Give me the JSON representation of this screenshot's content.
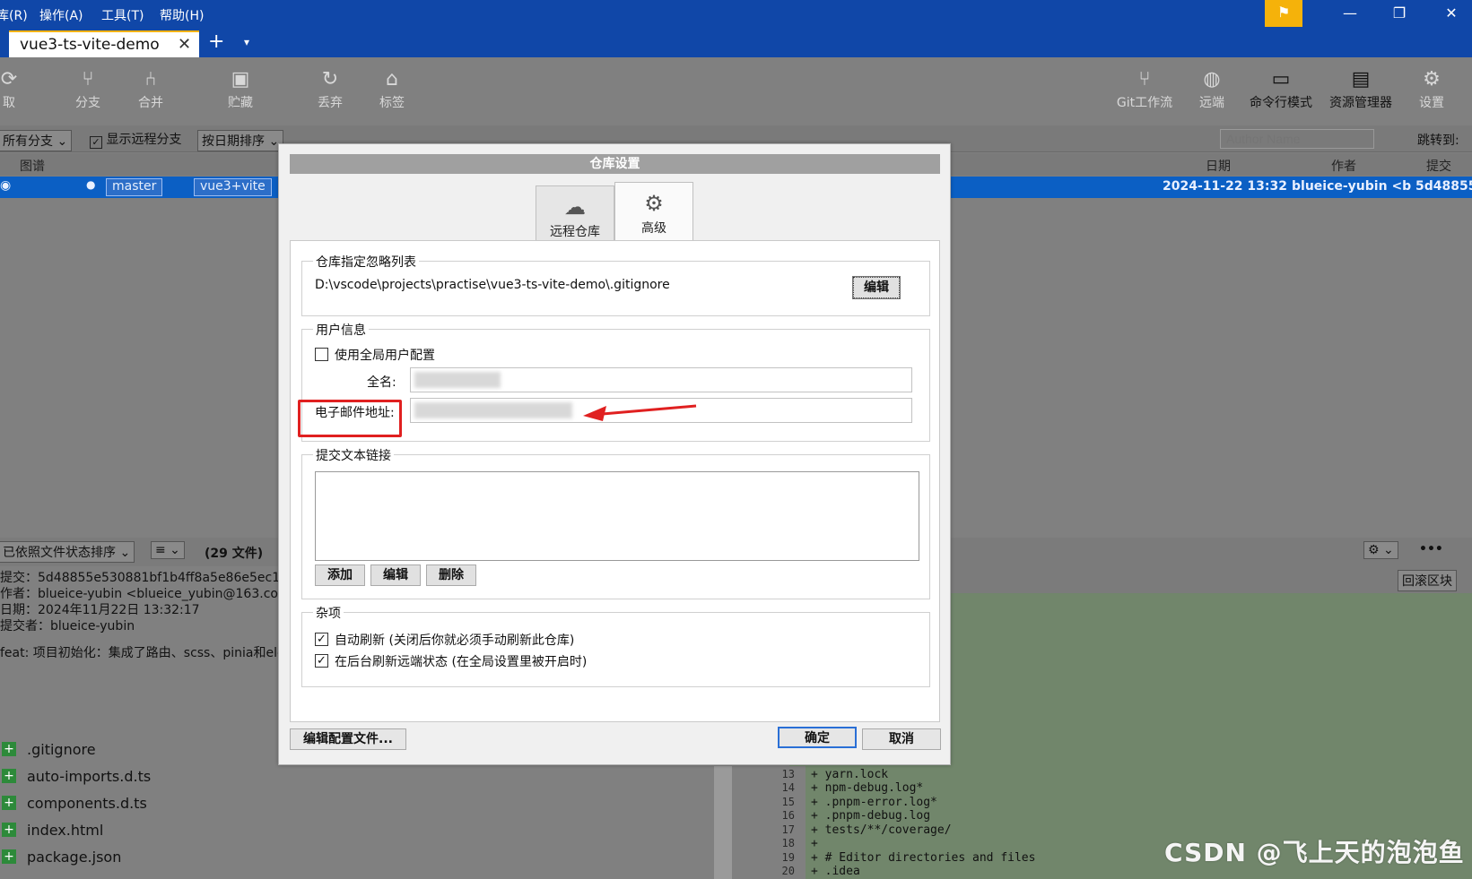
{
  "menu": {
    "items": [
      "库(R)",
      "操作(A)",
      "工具(T)",
      "帮助(H)"
    ]
  },
  "window": {
    "minimize": "—",
    "restore": "❐",
    "close": "✕",
    "flag_icon": "flag-icon"
  },
  "tabs": {
    "active_label": "vue3-ts-vite-demo",
    "close": "✕",
    "add": "+",
    "more": "▾"
  },
  "toolbar": {
    "left": [
      {
        "label": "取",
        "icon": "fetch-icon"
      },
      {
        "label": "分支",
        "icon": "branch-icon"
      },
      {
        "label": "合并",
        "icon": "merge-icon"
      },
      {
        "label": "贮藏",
        "icon": "stash-icon"
      },
      {
        "label": "丢弃",
        "icon": "discard-icon"
      },
      {
        "label": "标签",
        "icon": "tag-icon"
      }
    ],
    "right": [
      {
        "label": "Git工作流",
        "icon": "gitflow-icon"
      },
      {
        "label": "远端",
        "icon": "remote-icon"
      },
      {
        "label": "命令行模式",
        "icon": "terminal-icon"
      },
      {
        "label": "资源管理器",
        "icon": "explorer-icon"
      },
      {
        "label": "设置",
        "icon": "gear-icon"
      }
    ]
  },
  "filter": {
    "branches": "所有分支 ⌄",
    "show_remote": "显示远程分支",
    "sort": "按日期排序 ⌄",
    "author_placeholder": "Author Name",
    "jump": "跳转到:"
  },
  "graph_header": {
    "graph": "图谱",
    "date": "日期",
    "author": "作者",
    "commit": "提交"
  },
  "commit": {
    "branch1": "master",
    "branch2": "vue3+vite",
    "date": "2024-11-22 13:32",
    "author": "blueice-yubin <b",
    "hash": "5d48855"
  },
  "midbar": {
    "sort": "已依照文件状态排序 ⌄",
    "view": "≡ ⌄",
    "count": "(29 文件)",
    "gear": "⚙ ⌄",
    "more": "•••"
  },
  "diffbar": {
    "revert": "回滚区块"
  },
  "details": {
    "commit": "提交：5d48855e530881bf1b4ff8a5e86e5ec11",
    "author": "作者：blueice-yubin <blueice_yubin@163.com",
    "date": "日期：2024年11月22日 13:32:17",
    "committer": "提交者：blueice-yubin",
    "message": "feat: 项目初始化：集成了路由、scss、pinia和eleme"
  },
  "files": [
    ".gitignore",
    "auto-imports.d.ts",
    "components.d.ts",
    "index.html",
    "package.json"
  ],
  "diff": {
    "lines": [
      "13",
      "14",
      "15",
      "16",
      "17",
      "18",
      "19",
      "20"
    ],
    "code": [
      "+ yarn.lock",
      "+ npm-debug.log*",
      "+ .pnpm-error.log*",
      "+ .pnpm-debug.log",
      "+ tests/**/coverage/",
      "+",
      "+ # Editor directories and files",
      "+ .idea"
    ]
  },
  "dialog": {
    "title": "仓库设置",
    "tab_remote": "远程仓库",
    "tab_advanced": "高级",
    "ignore_group": "仓库指定忽略列表",
    "ignore_path": "D:\\vscode\\projects\\practise\\vue3-ts-vite-demo\\.gitignore",
    "edit": "编辑",
    "user_group": "用户信息",
    "use_global": "使用全局用户配置",
    "fullname_label": "全名:",
    "email_label": "电子邮件地址:",
    "links_group": "提交文本链接",
    "add": "添加",
    "edit2": "编辑",
    "delete": "删除",
    "misc_group": "杂项",
    "auto_refresh": "自动刷新 (关闭后你就必须手动刷新此仓库)",
    "bg_refresh": "在后台刷新远端状态 (在全局设置里被开启时)",
    "edit_config": "编辑配置文件...",
    "ok": "确定",
    "cancel": "取消"
  },
  "watermark": "CSDN @飞上天的泡泡鱼",
  "colors": {
    "accent": "#1047a8",
    "highlight": "#e02020",
    "flag": "#f5b20a"
  }
}
